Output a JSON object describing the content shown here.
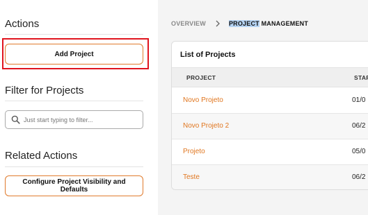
{
  "sidebar": {
    "actions_title": "Actions",
    "add_project_label": "Add Project",
    "filter_title": "Filter for Projects",
    "filter_placeholder": "Just start typing to filter...",
    "related_title": "Related Actions",
    "configure_label": "Configure Project Visibility and Defaults"
  },
  "breadcrumb": {
    "overview": "OVERVIEW",
    "current_highlight": "PROJECT",
    "current_rest": " MANAGEMENT"
  },
  "projects": {
    "title": "List of Projects",
    "columns": {
      "project": "PROJECT",
      "start": "STAR"
    },
    "rows": [
      {
        "name": "Novo Projeto",
        "start": "01/0"
      },
      {
        "name": "Novo Projeto 2",
        "start": "06/2"
      },
      {
        "name": "Projeto",
        "start": "05/0"
      },
      {
        "name": "Teste",
        "start": "06/2"
      }
    ]
  },
  "colors": {
    "accent": "#e0761f",
    "selection_outline": "#e0141e",
    "text_highlight": "#b5d3f3"
  },
  "icons": {
    "search": "search-icon",
    "breadcrumb_separator": "chevron-right-icon"
  }
}
